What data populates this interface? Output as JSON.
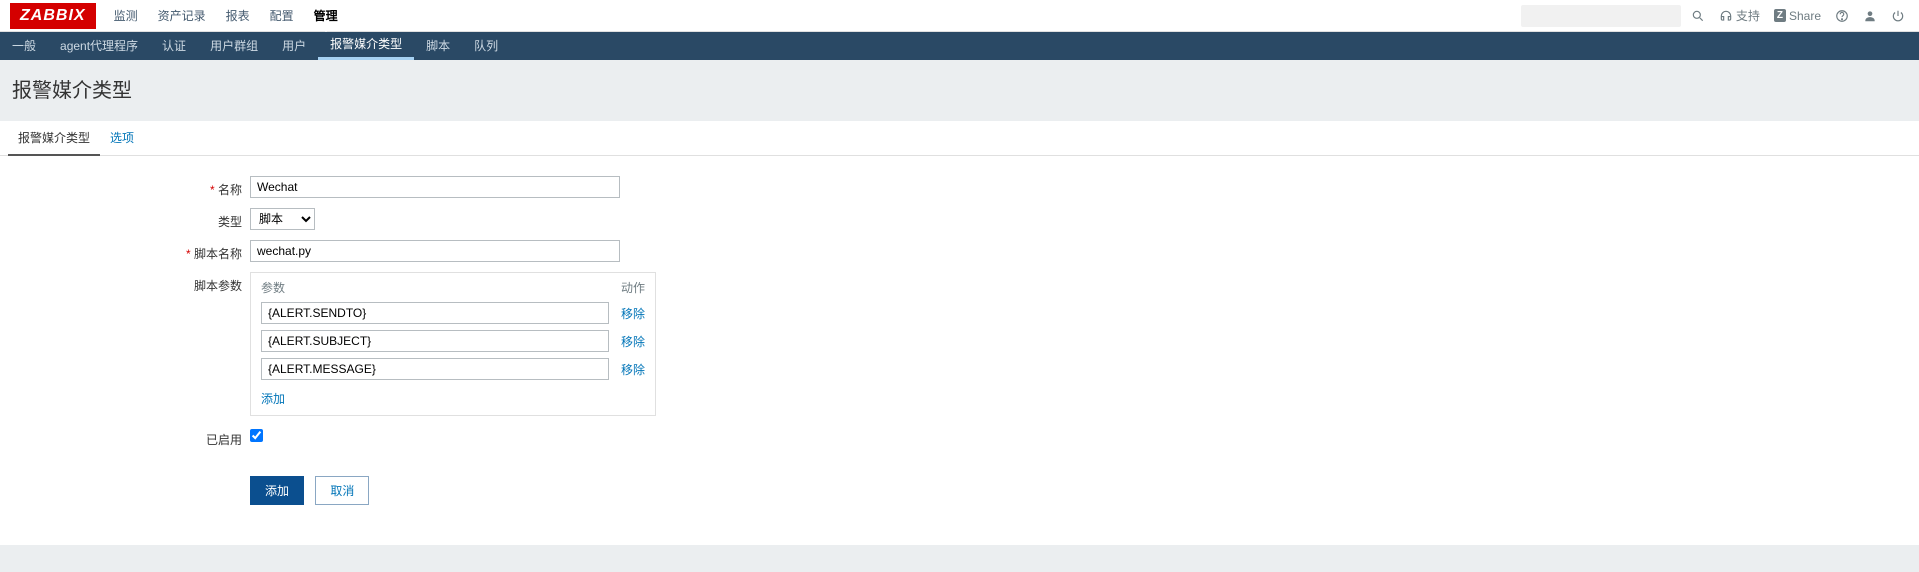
{
  "brand": "ZABBIX",
  "topnav": {
    "items": [
      "监测",
      "资产记录",
      "报表",
      "配置",
      "管理"
    ],
    "active_index": 4,
    "support": "支持",
    "share": "Share"
  },
  "subnav": {
    "items": [
      "一般",
      "agent代理程序",
      "认证",
      "用户群组",
      "用户",
      "报警媒介类型",
      "脚本",
      "队列"
    ],
    "active_index": 5
  },
  "page_title": "报警媒介类型",
  "tabs": {
    "items": [
      "报警媒介类型",
      "选项"
    ],
    "active_index": 0
  },
  "form": {
    "name_label": "名称",
    "name_value": "Wechat",
    "type_label": "类型",
    "type_value": "脚本",
    "script_name_label": "脚本名称",
    "script_name_value": "wechat.py",
    "script_params_label": "脚本参数",
    "params_header_param": "参数",
    "params_header_action": "动作",
    "params": [
      {
        "value": "{ALERT.SENDTO}"
      },
      {
        "value": "{ALERT.SUBJECT}"
      },
      {
        "value": "{ALERT.MESSAGE}"
      }
    ],
    "remove_label": "移除",
    "add_label": "添加",
    "enabled_label": "已启用",
    "enabled_checked": true,
    "submit_label": "添加",
    "cancel_label": "取消"
  }
}
